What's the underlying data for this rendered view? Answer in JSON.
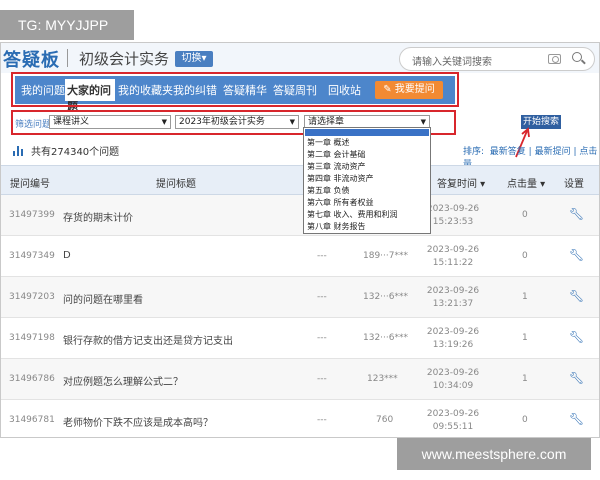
{
  "overlay": {
    "tag": "TG: MYYJJPP",
    "watermark": "www.meestsphere.com"
  },
  "header": {
    "logo": "答疑板",
    "subject": "初级会计实务",
    "switch_label": "切换▾",
    "search_placeholder": "请输入关键词搜索"
  },
  "nav": {
    "items": [
      "我的问题",
      "大家的问题",
      "我的收藏夹",
      "我的纠错",
      "答疑精华",
      "答疑周刊",
      "回收站"
    ],
    "active": "大家的问题",
    "ask_button": "✎ 我要提问"
  },
  "filter": {
    "label": "筛选问题",
    "course": "课程讲义",
    "year": "2023年初级会计实务",
    "chapter": "请选择章",
    "start_button": "开始搜索"
  },
  "stats": {
    "text": "共有274340个问题"
  },
  "sort": {
    "label": "排序:",
    "options": [
      "最新答复",
      "最新提问",
      "点击量"
    ]
  },
  "table": {
    "headers": [
      "提问编号",
      "提问标题",
      "答复时间",
      "点击量",
      "设置"
    ],
    "rows": [
      {
        "id": "31497399",
        "title": "存货的期末计价",
        "c3": "",
        "c4": "",
        "date": "2023-09-26",
        "time": "15:23:53",
        "clicks": "0"
      },
      {
        "id": "31497349",
        "title": "D",
        "c3": "---",
        "c4": "189···7***",
        "date": "2023-09-26",
        "time": "15:11:22",
        "clicks": "0"
      },
      {
        "id": "31497203",
        "title": "问的问题在哪里看",
        "c3": "---",
        "c4": "132···6***",
        "date": "2023-09-26",
        "time": "13:21:37",
        "clicks": "1"
      },
      {
        "id": "31497198",
        "title": "银行存款的借方记支出还是贷方记支出",
        "c3": "---",
        "c4": "132···6***",
        "date": "2023-09-26",
        "time": "13:19:26",
        "clicks": "1"
      },
      {
        "id": "31496786",
        "title": "对应例题怎么理解公式二？",
        "c3": "---",
        "c4": "123***",
        "date": "2023-09-26",
        "time": "10:34:09",
        "clicks": "1"
      },
      {
        "id": "31496781",
        "title": "老师物价下跌不应该是成本高吗？",
        "c3": "---",
        "c4": "760",
        "date": "2023-09-26",
        "time": "09:55:11",
        "clicks": "0"
      }
    ]
  },
  "dropdown": {
    "items": [
      "第一章 概述",
      "第二章 会计基础",
      "第三章 流动资产",
      "第四章 非流动资产",
      "第五章 负债",
      "第六章 所有者权益",
      "第七章 收入、费用和利润",
      "第八章 财务报告"
    ]
  },
  "colors": {
    "accent": "#4d86cb",
    "highlight": "#d8262c",
    "ask": "#f28a33"
  }
}
